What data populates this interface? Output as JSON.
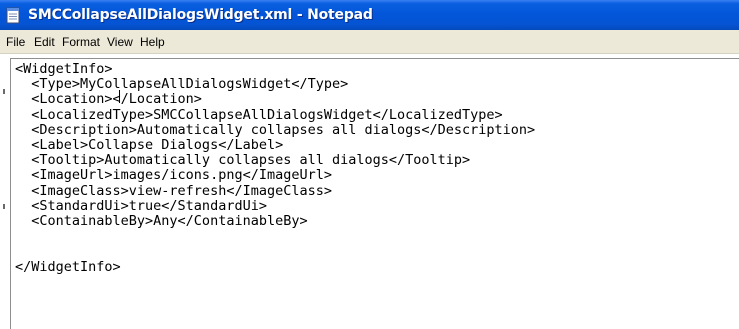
{
  "window": {
    "title": "SMCCollapseAllDialogsWidget.xml - Notepad",
    "icon": "notepad-icon"
  },
  "menu": {
    "items": [
      "File",
      "Edit",
      "Format",
      "View",
      "Help"
    ]
  },
  "editor": {
    "lines": [
      "<WidgetInfo>",
      "  <Type>MyCollapseAllDialogsWidget</Type>",
      "  <Location></Location>",
      "  <LocalizedType>SMCCollapseAllDialogsWidget</LocalizedType>",
      "  <Description>Automatically collapses all dialogs</Description>",
      "  <Label>Collapse Dialogs</Label>",
      "  <Tooltip>Automatically collapses all dialogs</Tooltip>",
      "  <ImageUrl>images/icons.png</ImageUrl>",
      "  <ImageClass>view-refresh</ImageClass>",
      "  <StandardUi>true</StandardUi>",
      "  <ContainableBy>Any</ContainableBy>",
      "",
      "",
      "</WidgetInfo>"
    ]
  },
  "colors": {
    "titlebar": "#0356d9",
    "menubar": "#ece9d8",
    "editor_bg": "#ffffff"
  }
}
